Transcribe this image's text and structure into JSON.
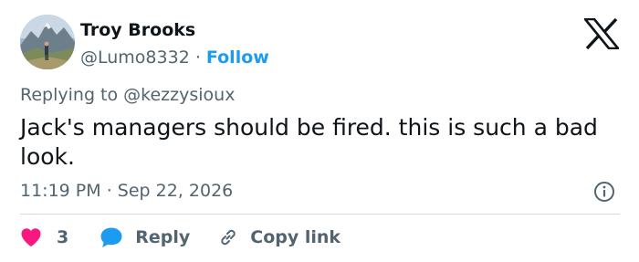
{
  "user": {
    "display_name": "Troy Brooks",
    "handle": "@Lumo8332",
    "separator": "·",
    "follow_label": "Follow"
  },
  "reply_context": {
    "prefix": "Replying to",
    "mention": "@kezzysioux"
  },
  "tweet": {
    "text": "Jack's managers should be fired. this is such a bad look."
  },
  "meta": {
    "time": "11:19 PM",
    "separator": "·",
    "date": "Sep 22, 2026"
  },
  "actions": {
    "like_count": "3",
    "reply_label": "Reply",
    "copy_link_label": "Copy link"
  },
  "colors": {
    "text_primary": "#0f1419",
    "text_secondary": "#536471",
    "link_blue": "#1d9bf0",
    "like_red": "#f91880",
    "divider": "#cfd9de"
  },
  "icons": {
    "brand": "x-logo-icon",
    "info": "info-icon",
    "like": "heart-icon",
    "reply": "speech-bubble-icon",
    "copy": "link-icon"
  }
}
